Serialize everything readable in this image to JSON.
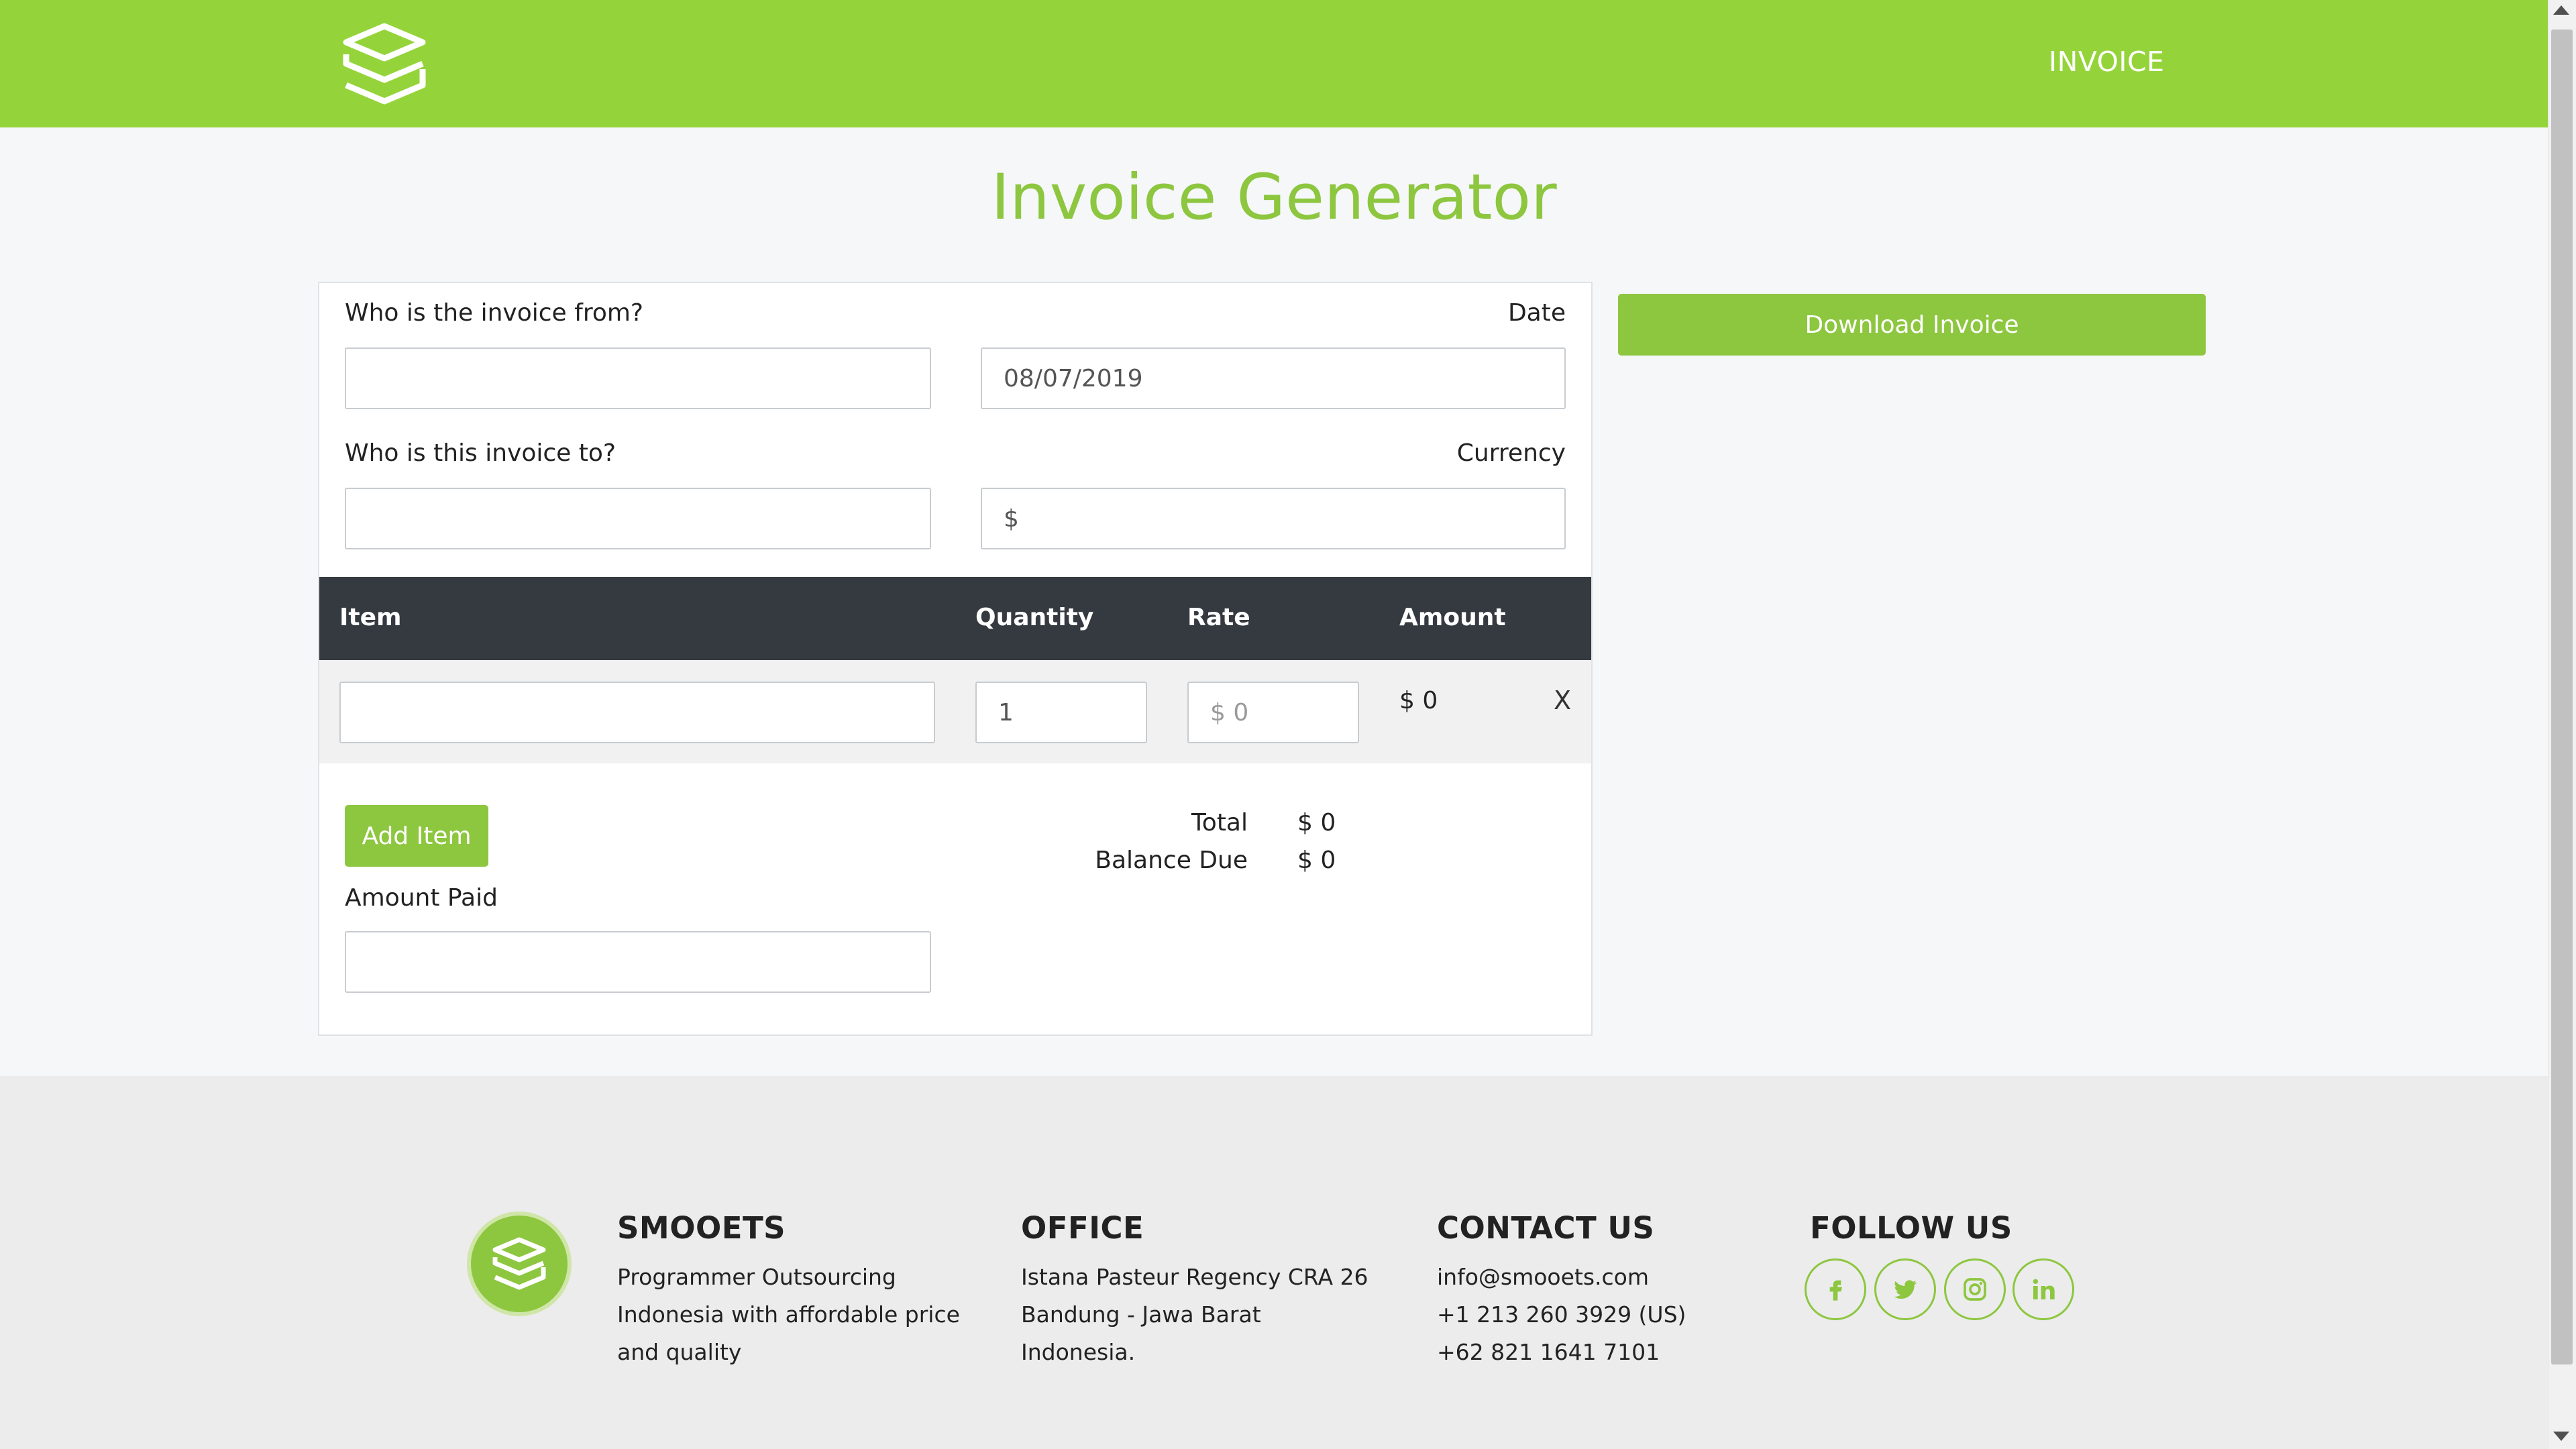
{
  "header": {
    "nav_label": "INVOICE"
  },
  "title": "Invoice Generator",
  "form": {
    "from_label": "Who is the invoice from?",
    "from_value": "",
    "date_label": "Date",
    "date_value": "08/07/2019",
    "to_label": "Who is this invoice to?",
    "to_value": "",
    "currency_label": "Currency",
    "currency_value": "$"
  },
  "table": {
    "headers": [
      "Item",
      "Quantity",
      "Rate",
      "Amount"
    ],
    "rows": [
      {
        "item": "",
        "quantity": "1",
        "rate_placeholder": "$ 0",
        "amount": "$ 0",
        "remove": "X"
      }
    ]
  },
  "add_item_label": "Add Item",
  "amount_paid_label": "Amount Paid",
  "totals": {
    "total_label": "Total",
    "total_value": "$ 0",
    "balance_label": "Balance Due",
    "balance_value": "$ 0"
  },
  "download_label": "Download Invoice",
  "footer": {
    "company": {
      "name": "SMOOETS",
      "lines": [
        "Programmer Outsourcing",
        "Indonesia with affordable price",
        "and quality"
      ]
    },
    "office": {
      "heading": "OFFICE",
      "lines": [
        "Istana Pasteur Regency CRA 26",
        "Bandung - Jawa Barat",
        "Indonesia."
      ]
    },
    "contact": {
      "heading": "CONTACT US",
      "lines": [
        "info@smooets.com",
        "+1 213 260 3929 (US)",
        "+62 821 1641 7101"
      ]
    },
    "follow": {
      "heading": "FOLLOW US",
      "icons": [
        "facebook-icon",
        "twitter-icon",
        "instagram-icon",
        "linkedin-icon"
      ]
    }
  },
  "colors": {
    "brand_green": "#94d43a",
    "dark_header": "#343a40"
  }
}
